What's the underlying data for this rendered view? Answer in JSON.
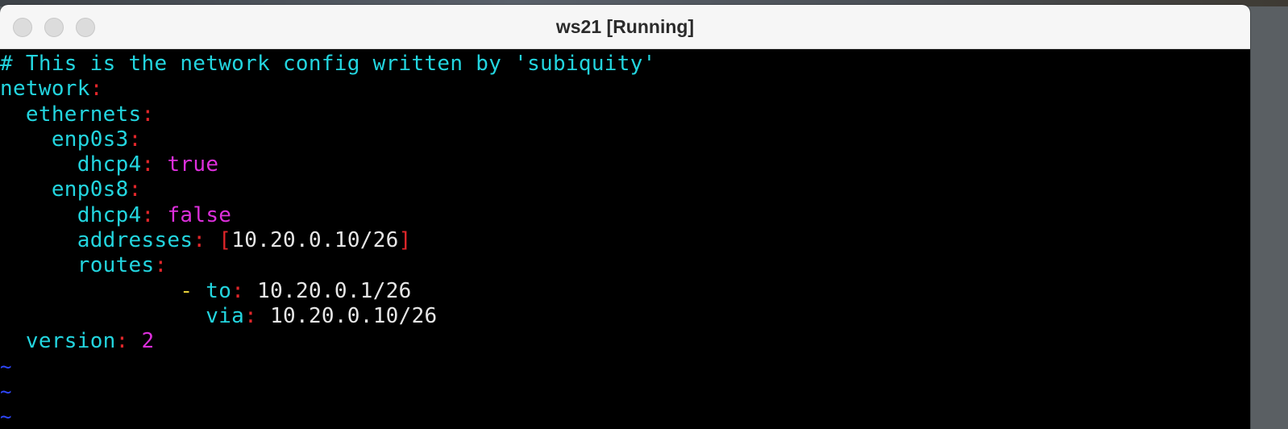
{
  "window": {
    "title": "ws21 [Running]"
  },
  "editor": {
    "comment": "# This is the network config written by 'subiquity'",
    "lines": {
      "network_key": "network",
      "ethernets_key": "ethernets",
      "iface1_key": "enp0s3",
      "iface1_dhcp4_key": "dhcp4",
      "iface1_dhcp4_value": "true",
      "iface2_key": "enp0s8",
      "iface2_dhcp4_key": "dhcp4",
      "iface2_dhcp4_value": "false",
      "addresses_key": "addresses",
      "address_value": "10.20.0.10/26",
      "routes_key": "routes",
      "route_dash": "-",
      "route_to_key": "to",
      "route_to_value": "10.20.0.1/26",
      "route_via_key": "via",
      "route_via_value": "10.20.0.10/26",
      "version_key": "version",
      "version_value": "2"
    },
    "syntax": {
      "colon": ":",
      "bracket_open": "[",
      "bracket_close": "]"
    },
    "empty_line_marker": "~",
    "colors": {
      "background": "#000000",
      "key": "#23d5df",
      "punctuation": "#e0262a",
      "literal": "#dd2fdc",
      "string": "#e6e6e6",
      "list_dash": "#e7d13a",
      "tilde": "#2f47ff"
    }
  }
}
